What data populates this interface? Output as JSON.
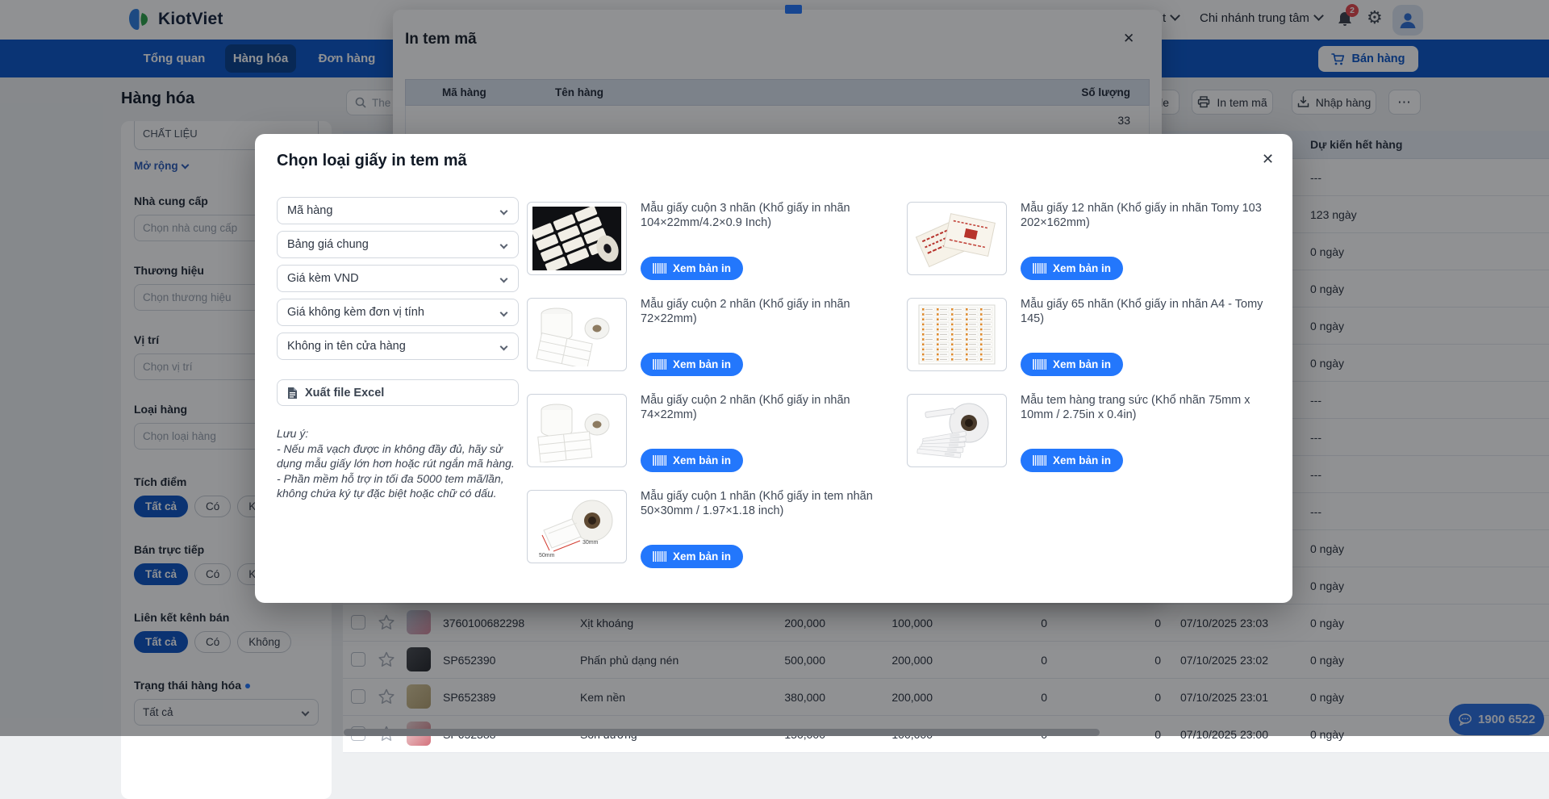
{
  "icons": {
    "close": "✕",
    "more": "⋯"
  },
  "colors": {
    "accent": "#2377fc",
    "navbar": "#0b57c9",
    "nav_active": "#09418f",
    "badge": "#e5484d",
    "pill_on": "#0d55c4"
  },
  "header": {
    "brand": "KiotViet",
    "partial_account_label": "t",
    "branch": "Chi nhánh trung tâm",
    "notif_badge": "2"
  },
  "nav": {
    "tabs": [
      {
        "label": "Tổng quan",
        "active": false
      },
      {
        "label": "Hàng hóa",
        "active": true
      },
      {
        "label": "Đơn hàng",
        "active": false
      }
    ],
    "sell": "Bán hàng"
  },
  "page": {
    "title": "Hàng hóa",
    "search_text": "The",
    "toolbar": {
      "partial": "le",
      "print": "In tem mã",
      "import": "Nhập hàng"
    }
  },
  "sidebar": {
    "top_input_value": "CHẤT LIỆU",
    "expand": "Mở rộng",
    "filters": [
      {
        "label": "Nhà cung cấp",
        "placeholder": "Chọn nhà cung cấp"
      },
      {
        "label": "Thương hiệu",
        "placeholder": "Chọn thương hiệu"
      },
      {
        "label": "Vị trí",
        "placeholder": "Chọn vị trí"
      },
      {
        "label": "Loại hàng",
        "placeholder": "Chọn loại hàng"
      }
    ],
    "pill_groups": [
      {
        "label": "Tích điểm",
        "options": [
          "Tất cả",
          "Có",
          "Không"
        ],
        "selected": "Tất cả"
      },
      {
        "label": "Bán trực tiếp",
        "options": [
          "Tất cả",
          "Có",
          "Không"
        ],
        "selected": "Tất cả"
      },
      {
        "label": "Liên kết kênh bán",
        "options": [
          "Tất cả",
          "Có",
          "Không"
        ],
        "selected": "Tất cả"
      }
    ],
    "status": {
      "label": "Trạng thái hàng hóa",
      "value": "Tất cả"
    }
  },
  "table": {
    "stock_col": "Dự kiến hết hàng",
    "rows": [
      {
        "stock": "---"
      },
      {
        "stock": "123 ngày"
      },
      {
        "stock": "0 ngày"
      },
      {
        "stock": "0 ngày"
      },
      {
        "stock": "0 ngày"
      },
      {
        "stock": "0 ngày"
      },
      {
        "stock": "---"
      },
      {
        "stock": "---"
      },
      {
        "stock": "---"
      },
      {
        "stock": "---"
      },
      {
        "stock": "0 ngày"
      },
      {
        "stock": "0 ngày"
      },
      {
        "code": "3760100682298",
        "name": "Xịt khoáng",
        "price": "200,000",
        "cost": "100,000",
        "qty": "0",
        "ordered": "0",
        "created": "07/10/2025 23:03",
        "stock": "0 ngày",
        "thumb": [
          "#c7d4e4",
          "#d98ca0"
        ]
      },
      {
        "code": "SP652390",
        "name": "Phấn phủ dạng nén",
        "price": "500,000",
        "cost": "200,000",
        "qty": "0",
        "ordered": "0",
        "created": "07/10/2025 23:02",
        "stock": "0 ngày",
        "thumb": [
          "#4a4d52",
          "#26282c"
        ]
      },
      {
        "code": "SP652389",
        "name": "Kem nền",
        "price": "380,000",
        "cost": "200,000",
        "qty": "0",
        "ordered": "0",
        "created": "07/10/2025 23:01",
        "stock": "0 ngày",
        "thumb": [
          "#d6c79b",
          "#b4a172"
        ]
      },
      {
        "code": "SP652388",
        "name": "Son dưỡng",
        "price": "150,000",
        "cost": "100,000",
        "qty": "0",
        "ordered": "0",
        "created": "07/10/2025 23:00",
        "stock": "0 ngày",
        "thumb": [
          "#efd7d8",
          "#d4717c"
        ]
      }
    ]
  },
  "print_modal": {
    "title": "In tem mã",
    "cols": [
      "Mã hàng",
      "Tên hàng",
      "Số lượng"
    ],
    "qty": "33"
  },
  "paper_modal": {
    "title": "Chọn loại giấy in tem mã",
    "selects": [
      "Mã hàng",
      "Bảng giá chung",
      "Giá kèm VND",
      "Giá không kèm đơn vị tính",
      "Không in tên cửa hàng"
    ],
    "excel": "Xuất file Excel",
    "notes": [
      "Lưu ý:",
      "- Nếu mã vạch được in không đầy đủ, hãy sử dụng mẫu giấy lớn hơn hoặc rút ngắn mã hàng.",
      "- Phần mềm hỗ trợ in tối đa 5000 tem mã/lần, không chứa ký tự đặc biệt hoặc chữ có dấu."
    ],
    "print_btn": "Xem bản in",
    "options_left": [
      {
        "title": "Mẫu giấy cuộn 3 nhãn (Khổ giấy in nhãn 104×22mm/4.2×0.9 Inch)",
        "art": "roll3"
      },
      {
        "title": "Mẫu giấy cuộn 2 nhãn (Khổ giấy in nhãn 72×22mm)",
        "art": "roll2"
      },
      {
        "title": "Mẫu giấy cuộn 2 nhãn (Khổ giấy in nhãn 74×22mm)",
        "art": "roll2b"
      },
      {
        "title": "Mẫu giấy cuộn 1 nhãn (Khổ giấy in tem nhãn 50×30mm / 1.97×1.18 inch)",
        "art": "roll1",
        "dims": [
          "50mm",
          "30mm"
        ]
      }
    ],
    "options_right": [
      {
        "title": "Mẫu giấy 12 nhãn (Khổ giấy in nhãn Tomy 103 202×162mm)",
        "art": "tomy12"
      },
      {
        "title": "Mẫu giấy 65 nhãn (Khổ giấy in nhãn A4 - Tomy 145)",
        "art": "tomy65"
      },
      {
        "title": "Mẫu tem hàng trang sức (Khổ nhãn 75mm x 10mm / 2.75in x 0.4in)",
        "art": "jewelry"
      }
    ]
  },
  "chat": {
    "label": "1900 6522"
  }
}
